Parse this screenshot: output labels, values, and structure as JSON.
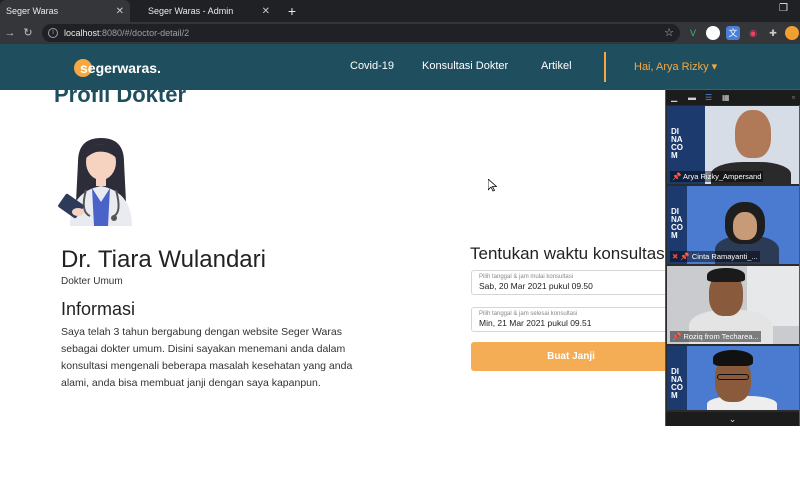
{
  "browser": {
    "tabs": [
      {
        "title": "Seger Waras",
        "active": true
      },
      {
        "title": "Seger Waras - Admin",
        "active": false
      }
    ],
    "url_host": "localhost",
    "url_path": ":8080/#/doctor-detail/2"
  },
  "nav": {
    "brand": "segerwaras.",
    "links": [
      "Covid-19",
      "Konsultasi Dokter",
      "Artikel"
    ],
    "user": "Hai, Arya Rizky"
  },
  "page": {
    "title": "Profil Dokter",
    "doctor_name": "Dr. Tiara Wulandari",
    "doctor_role": "Dokter Umum",
    "info_heading": "Informasi",
    "info_text": "Saya telah 3 tahun bergabung dengan website Seger Waras sebagai dokter umum. Disini sayakan menemani anda dalam konsultasi mengenali beberapa masalah kesehatan yang anda alami, anda bisa membuat janji dengan saya kapanpun."
  },
  "schedule": {
    "heading": "Tentukan waktu konsultasi",
    "start_label": "Pilih tanggal & jam mulai konsultasi",
    "start_value": "Sab, 20 Mar 2021 pukul 09.50",
    "end_label": "Pilih tanggal & jam selesai konsultasi",
    "end_value": "Min, 21 Mar 2021 pukul 09.51",
    "button": "Buat Janji"
  },
  "meeting": {
    "tile_logo_lines": [
      "DI",
      "NA",
      "CO",
      "M"
    ],
    "participants": [
      {
        "name": "Arya Rizky_Ampersand"
      },
      {
        "name": "Cinta Ramayanti_..."
      },
      {
        "name": "Roziq from Techarea..."
      },
      {
        "name": ""
      }
    ]
  },
  "colors": {
    "nav_bg": "#1f4e5f",
    "accent": "#f5a742",
    "button": "#f4ad55"
  }
}
